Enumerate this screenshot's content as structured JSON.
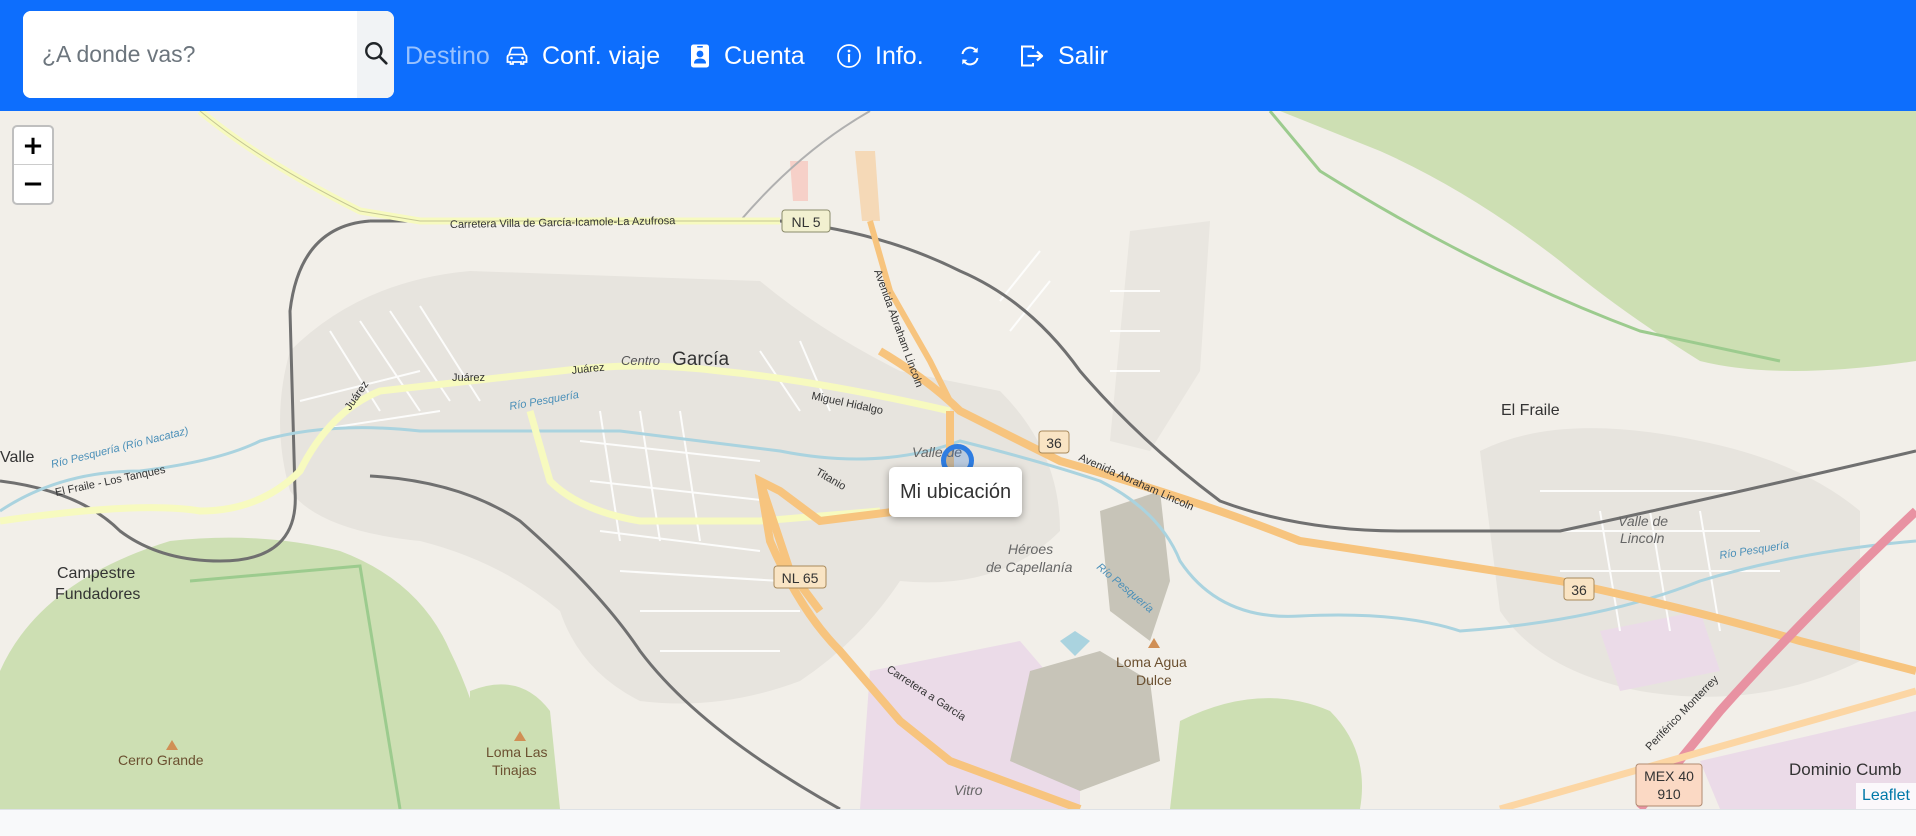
{
  "navbar": {
    "search": {
      "placeholder": "¿A donde vas?",
      "value": ""
    },
    "items": [
      {
        "label": "Destino",
        "icon": "",
        "enabled": false
      },
      {
        "label": "Conf. viaje",
        "icon": "car-icon"
      },
      {
        "label": "Cuenta",
        "icon": "id-badge-icon"
      },
      {
        "label": "Info.",
        "icon": "info-icon"
      },
      {
        "label": "",
        "icon": "refresh-icon"
      },
      {
        "label": "Salir",
        "icon": "logout-icon"
      }
    ],
    "colors": {
      "background": "#0d6efd",
      "text": "#ffffff"
    }
  },
  "map": {
    "zoom_in": "+",
    "zoom_out": "−",
    "popup": "Mi ubicación",
    "attribution": "Leaflet",
    "place_labels": {
      "garcia": "García",
      "centro": "Centro",
      "el_fraile": "El Fraile",
      "valle": "Valle",
      "campestre_1": "Campestre",
      "campestre_2": "Fundadores",
      "heroes_1": "Héroes",
      "heroes_2": "de Capellanía",
      "loma_agua_1": "Loma Agua",
      "loma_agua_2": "Dulce",
      "loma_tinajas_1": "Loma Las",
      "loma_tinajas_2": "Tinajas",
      "cerro_grande": "Cerro Grande",
      "valle_lincoln_1": "Valle de",
      "valle_lincoln_2": "Lincoln",
      "dominio": "Dominio Cumb",
      "vitro": "Vitro",
      "valle_de": "Valle de"
    },
    "road_labels": {
      "carretera_villa": "Carretera Villa de García-Icamole-La Azufrosa",
      "juarez_1": "Juárez",
      "juarez_2": "Juárez",
      "juarez_3": "Juárez",
      "rio_pesqueria_1": "Río Pesquería",
      "rio_pesqueria_2": "Río Pesquería",
      "rio_pesqueria_3": "Río Pesquería",
      "rio_nacatas": "Río Pesquería (Río Nacataz)",
      "el_fraile_tanques": "El Fraile - Los Tanques",
      "miguel_hidalgo": "Miguel Hidalgo",
      "abraham_1": "Avenida Abraham Lincoln",
      "abraham_2": "Avenida Abraham Lincoln",
      "titanio": "Titanio",
      "carretera_garcia": "Carretera a García",
      "periferico": "Periférico Monterrey"
    },
    "shields": {
      "nl5": "NL 5",
      "r36a": "36",
      "r36b": "36",
      "nl65": "NL 65",
      "mex40_1": "MEX 40",
      "mex40_2": "910"
    }
  }
}
